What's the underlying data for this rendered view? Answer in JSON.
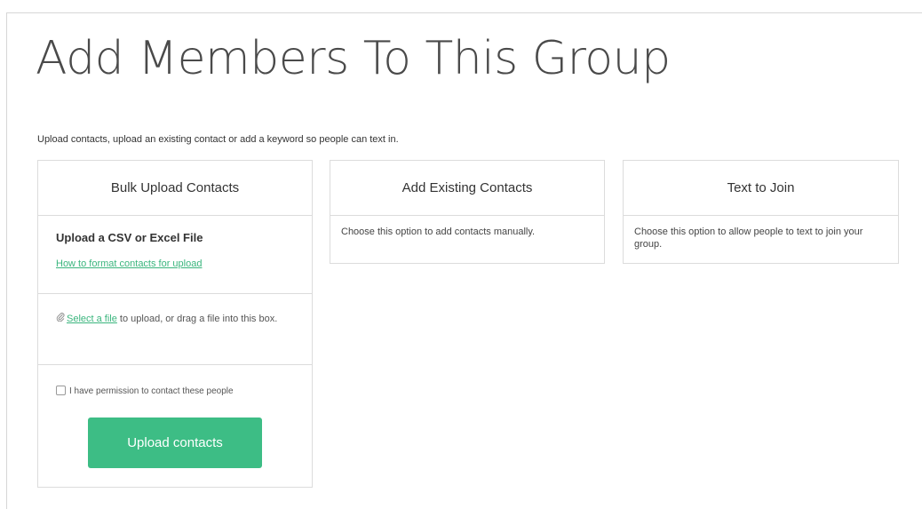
{
  "page": {
    "title": "Add Members To This Group",
    "subtitle": "Upload contacts, upload an existing contact or add a keyword so people can text in."
  },
  "cards": {
    "bulk": {
      "header": "Bulk Upload Contacts",
      "csv_title": "Upload a CSV or Excel File",
      "format_link": "How to format contacts for upload",
      "file_link": "Select a file",
      "file_text": " to upload, or drag a file into this box.",
      "permission_label": "I have permission to contact these people",
      "permission_checked": false,
      "upload_button": "Upload contacts"
    },
    "existing": {
      "header": "Add Existing Contacts",
      "body": "Choose this option to add contacts manually."
    },
    "text_join": {
      "header": "Text to Join",
      "body": "Choose this option to allow people to text to join your group."
    }
  },
  "icons": {
    "attachment": "paperclip-icon"
  },
  "colors": {
    "accent": "#3dbd85",
    "link": "#3ab57d",
    "border": "#dcdcdc"
  }
}
